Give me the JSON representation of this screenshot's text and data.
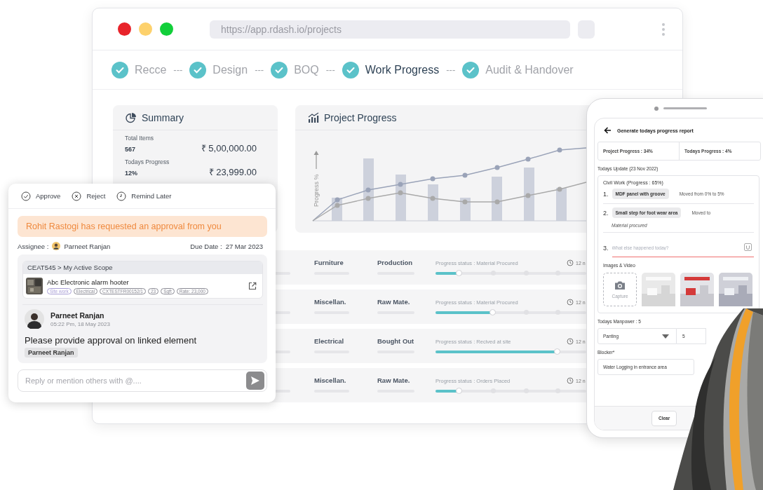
{
  "browser": {
    "url": "https://app.rdash.io/projects"
  },
  "steps": [
    {
      "label": "Recce",
      "selected": false,
      "separator": "---"
    },
    {
      "label": "Design",
      "selected": false,
      "separator": "---"
    },
    {
      "label": "BOQ",
      "selected": false,
      "separator": "---"
    },
    {
      "label": "Work Progress",
      "selected": true,
      "separator": "---"
    },
    {
      "label": "Audit & Handover",
      "selected": false
    }
  ],
  "summary": {
    "title": "Summary",
    "items": [
      {
        "label": "Total Items",
        "count": "567",
        "amount": "₹ 5,00,000.00"
      },
      {
        "label": "Todays Progress",
        "count": "12%",
        "amount": "₹ 23,999.00"
      }
    ]
  },
  "project_progress": {
    "title": "Project Progress",
    "ylabel": "Progress %"
  },
  "tasks": [
    {
      "category": "Furniture",
      "type": "Production",
      "status": "Progress status : Material Procured",
      "level": 0.16,
      "time": "12 n"
    },
    {
      "category": "Miscellan.",
      "type": "Raw Mate.",
      "status": "Progress status : Material Procured",
      "level": 0.38,
      "time": "12 n"
    },
    {
      "category": "Electrical",
      "type": "Bought Out",
      "status": "Progress status : Recived at site",
      "level": 0.81,
      "time": "12 n"
    },
    {
      "category": "Miscellan.",
      "type": "Raw Mate.",
      "status": "Progress status : Orders Placed",
      "level": 0.16,
      "time": "12 n"
    }
  ],
  "approval": {
    "actions": [
      "Approve",
      "Reject",
      "Remind Later"
    ],
    "banner": "Rohit Rastogi has requested an approval from you",
    "assignee_label": "Assignee :",
    "assignee": "Parneet Ranjan",
    "due_label": "Due Date :",
    "due_date": "27 Mar 2023",
    "scope": {
      "path": "CEAT545 > My Active Scope",
      "item": "Abc Electronic alarm hooter",
      "tags": [
        {
          "label": "Site work",
          "color": "#a99fd6"
        },
        {
          "label": "Electrical",
          "color": "#8a8a94"
        },
        {
          "label": "CXTESTFR00152/1",
          "color": "#8a8a94"
        },
        {
          "label": "23",
          "color": "#8a8a94"
        },
        {
          "label": "Sqft",
          "color": "#8a8a94"
        },
        {
          "label": "Rate: 23,000",
          "color": "#8a8a94"
        }
      ]
    },
    "comment": {
      "author": "Parneet Ranjan",
      "time": "05:22 Pm, 18 May 2023",
      "message": "Please provide approval on linked element",
      "mention": "Parneet Ranjan"
    },
    "reply": {
      "placeholder": "Reply or mention others with @...."
    }
  },
  "phone": {
    "title": "Generate todays progress report",
    "stats": [
      "Project Progress : 34%",
      "Todays Progress : 4%"
    ],
    "update_heading": "Todays Update (23 Nov 2022)",
    "work": {
      "title": "Civil Work (Progress : 65%)",
      "entries": [
        {
          "number": "1.",
          "item": "MDF panel with groove",
          "note": "Moved from 0% to 5%"
        },
        {
          "number": "2.",
          "item": "Small step for foot wear area",
          "note": "Moved to",
          "detail": "Material procured"
        }
      ],
      "new_entry": {
        "number": "3.",
        "placeholder": "What else happened today?"
      }
    },
    "media_heading": "Images & Video",
    "media": [
      {
        "kind": "capture",
        "label": "Capture"
      },
      {
        "kind": "picture"
      },
      {
        "kind": "picture"
      },
      {
        "kind": "picture"
      }
    ],
    "manpower_heading": "Todays Manpower : 5",
    "manpower": {
      "trade": "Panting",
      "count": "5"
    },
    "blocker_heading": "Blocker*",
    "blocker": "Water Logging in entrance area",
    "buttons": [
      "Clear"
    ]
  }
}
